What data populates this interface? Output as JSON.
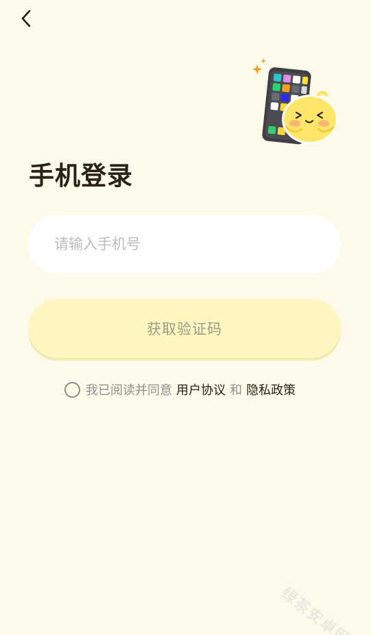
{
  "nav": {
    "back_icon": "chevron-left-icon"
  },
  "illustration": {
    "icon": "phone-chick-mascot-icon"
  },
  "login": {
    "title": "手机登录",
    "phone_placeholder": "请输入手机号",
    "phone_value": "",
    "get_code_label": "获取验证码"
  },
  "agreement": {
    "prefix": "我已阅读并同意",
    "user_agreement": "用户协议",
    "conjunction": "和",
    "privacy_policy": "隐私政策",
    "checked": false
  },
  "watermark": {
    "text": "绿茶安卓网"
  },
  "colors": {
    "background": "#fefaea",
    "button_bg": "#fdf6c0",
    "title_text": "#2a2118",
    "placeholder": "#bcbcbc"
  }
}
